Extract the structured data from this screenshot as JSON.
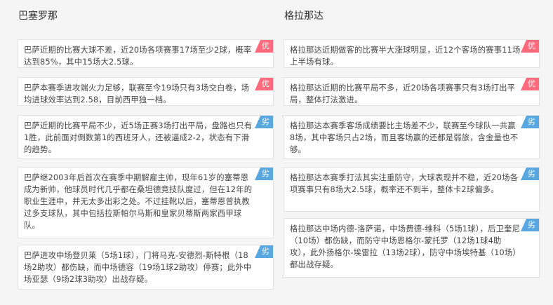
{
  "teams": [
    {
      "name": "巴塞罗那",
      "cards": [
        {
          "text": "巴萨近期的比赛大球不差，近20场各项赛事17场至少2球，概率达到85%，其中15场大2.5球。",
          "badge": "优",
          "type": "good"
        },
        {
          "text": "巴萨本赛季进攻端火力足够，联赛至今19场只有3场交白卷，场均进球效率达到2.58，目前西甲独一档。",
          "badge": "优",
          "type": "good"
        },
        {
          "text": "巴萨近期的比赛平局不少，近5场正赛3场打出平局，盘路也只有1胜，此前面对倒数第1的西班牙人，还被逼成2-2，状态有下滑的趋势。",
          "badge": "劣",
          "type": "bad"
        },
        {
          "text": "巴萨继2003年后首次在赛季中期解雇主帅，现年61岁的塞蒂恩成为新帅，他球员时代几乎都在桑坦德竞技队度过，但在12年的职业生涯中，并无太多出彩之处。不过挂靴以后，塞蒂恩曾执教过多支球队，其中包括拉斯帕尔马斯和皇家贝蒂斯两家西甲球队。",
          "badge": "劣",
          "type": "bad"
        },
        {
          "text": "巴萨进攻中场登贝莱（5场1球），门将马克-安德烈-斯特根（18场2助攻）都伤缺，而中场德容（19场1球2助攻）停赛；此外中场亚瑟（9场2球3助攻）出战存疑。",
          "badge": "劣",
          "type": "bad"
        }
      ]
    },
    {
      "name": "格拉那达",
      "cards": [
        {
          "text": "格拉那达近期做客的比赛半大涨球明显，近12个客场的赛事11场上半场有球。",
          "badge": "优",
          "type": "good"
        },
        {
          "text": "格拉那达近期的比赛平局不多，近20场各项赛事只有3场打出平局，整体打法激进。",
          "badge": "优",
          "type": "good"
        },
        {
          "text": "格拉那达本赛季客场成绩要比主场差不少，联赛至今球队一共赢8场，其中客场只占2场，而且客场赢的还都是弱旅，含金量也不够。",
          "badge": "劣",
          "type": "bad"
        },
        {
          "text": "格拉那达本赛季打法其实注重防守，大球表现并不稳，近20场各项赛事只有8场大2.5球，概率还不到半，整体卡2球偏多。",
          "badge": "劣",
          "type": "bad"
        },
        {
          "text": "格拉那达中场内德-洛萨诺，中场费德-维科（5场1球），后卫奎尼（10场）都伤缺，而防守中场恩格尔-蒙托罗（12场1球4助攻），此外扬格尔-埃雷拉（13场2球），防守中场埃特基（10场）都出战存疑。",
          "badge": "劣",
          "type": "bad"
        }
      ]
    }
  ]
}
